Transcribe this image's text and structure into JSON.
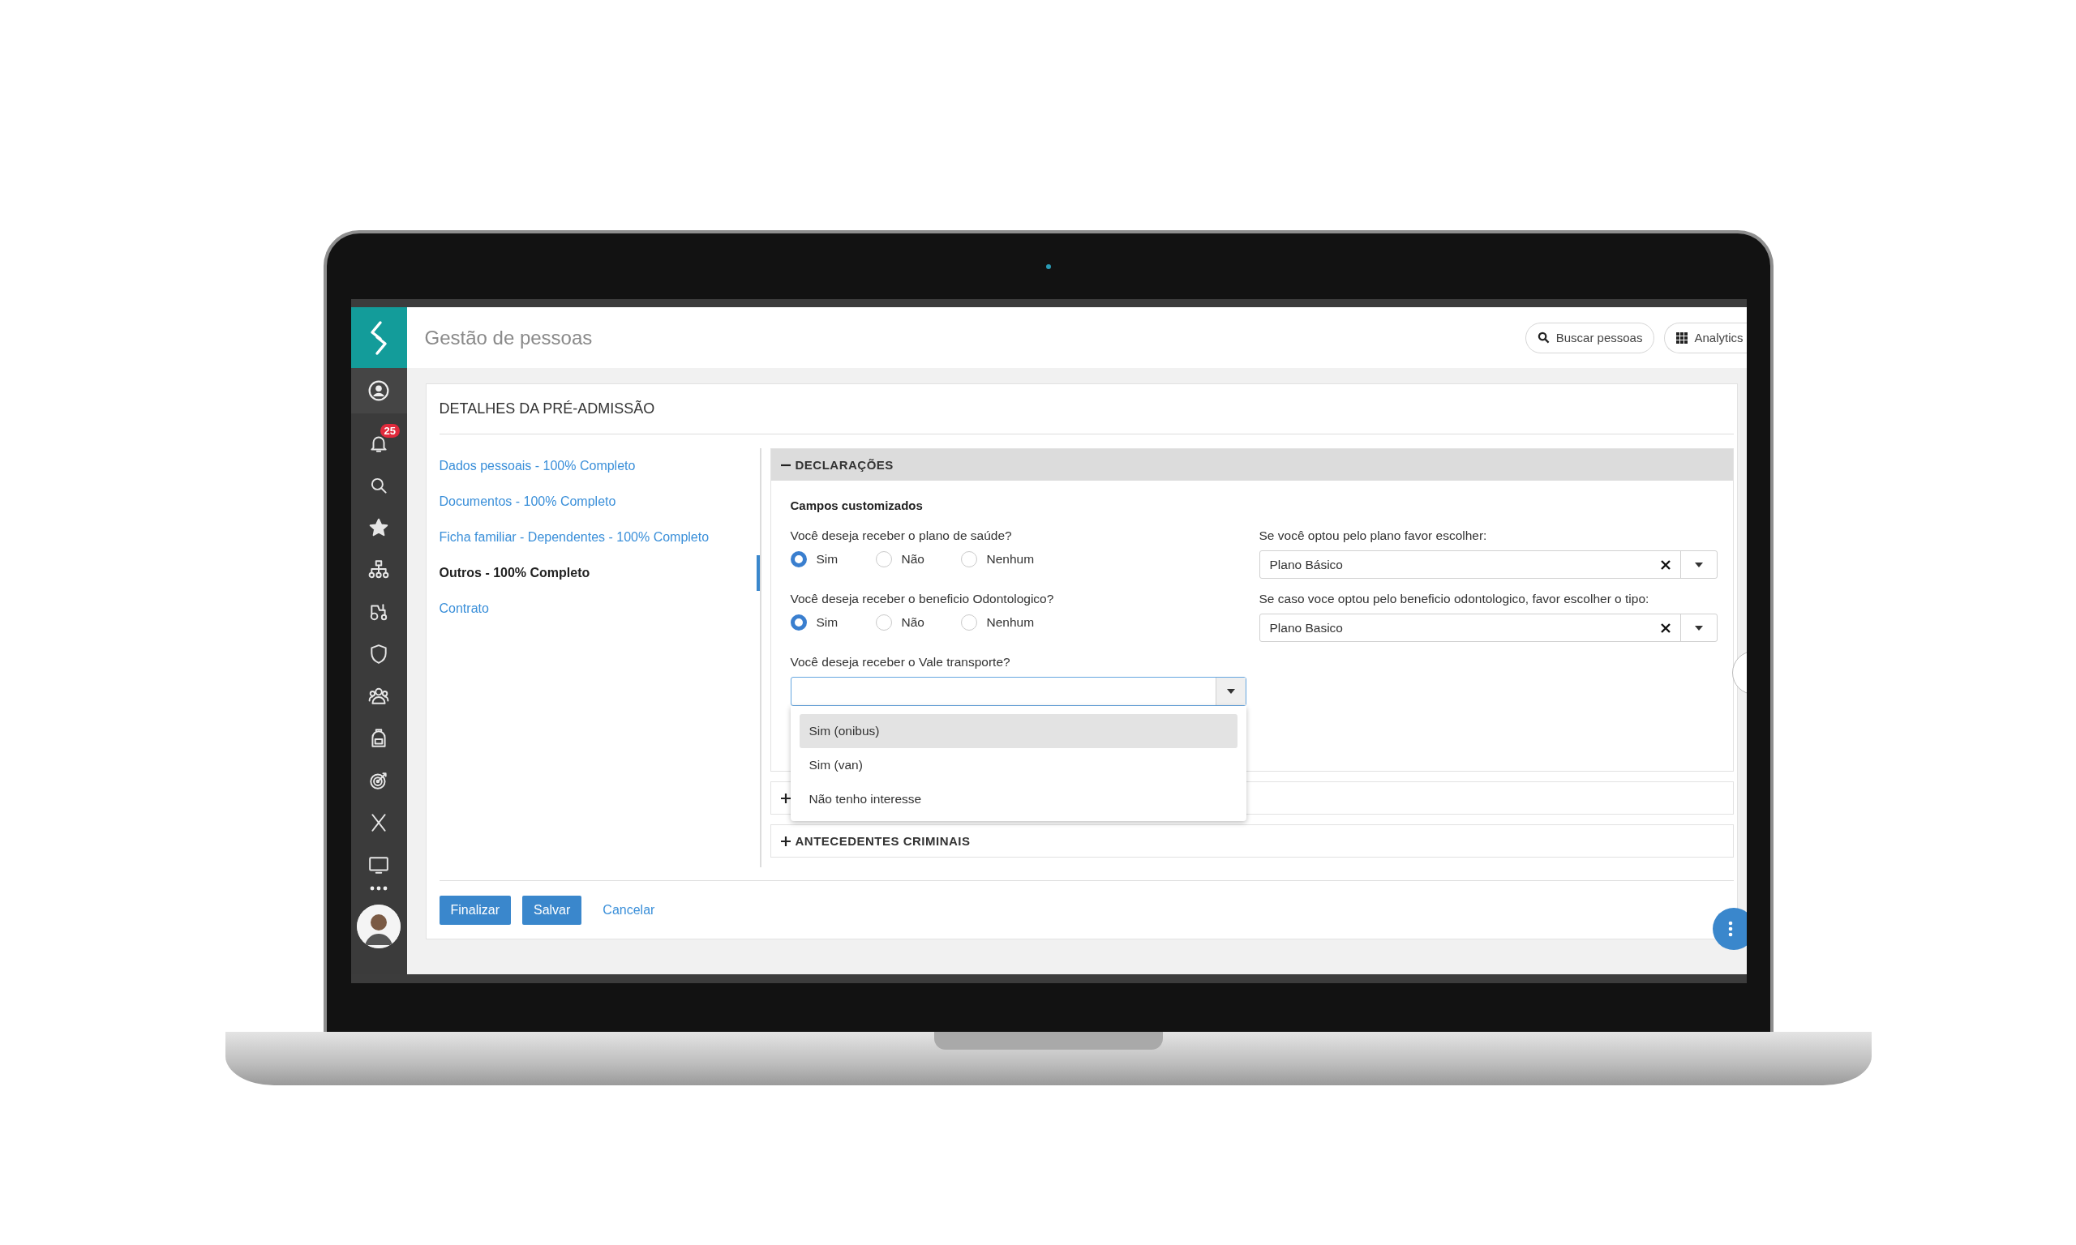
{
  "header": {
    "title": "Gestão de pessoas",
    "buttons": [
      {
        "label": "Buscar pessoas",
        "kind": "search"
      },
      {
        "label": "Analytics",
        "kind": "apps"
      }
    ]
  },
  "sidebar": {
    "notification_count": "25"
  },
  "page": {
    "title": "DETALHES DA PRÉ-ADMISSÃO"
  },
  "steps": [
    {
      "label": "Dados pessoais - 100% Completo",
      "selected": false
    },
    {
      "label": "Documentos - 100% Completo",
      "selected": false
    },
    {
      "label": "Ficha familiar - Dependentes - 100% Completo",
      "selected": false
    },
    {
      "label": "Outros - 100% Completo",
      "selected": true
    },
    {
      "label": "Contrato",
      "selected": false
    }
  ],
  "sections": [
    {
      "title": "DECLARAÇÕES",
      "expanded": true
    },
    {
      "expanded": false
    },
    {
      "title": "ANTECEDENTES CRIMINAIS",
      "expanded": false
    }
  ],
  "form": {
    "heading": "Campos customizados",
    "questions": [
      {
        "kind": "radio",
        "label": "Você deseja receber o plano de saúde?",
        "options": [
          {
            "label": "Sim",
            "selected": true
          },
          {
            "label": "Não",
            "selected": false
          },
          {
            "label": "Nenhum",
            "selected": false
          }
        ]
      },
      {
        "kind": "radio",
        "label": "Você deseja receber o beneficio Odontologico?",
        "options": [
          {
            "label": "Sim",
            "selected": true
          },
          {
            "label": "Não",
            "selected": false
          },
          {
            "label": "Nenhum",
            "selected": false
          }
        ]
      },
      {
        "kind": "select",
        "label": "Você deseja receber o Vale transporte?",
        "expanded": true,
        "options": [
          {
            "label": "Sim (onibus)",
            "selected": true
          },
          {
            "label": "Sim (van)",
            "selected": false
          },
          {
            "label": "Não tenho interesse",
            "selected": false
          }
        ]
      }
    ],
    "choices": [
      {
        "label": "Se você optou pelo plano favor escolher:",
        "value": "Plano Básico"
      },
      {
        "label": "Se caso voce optou pelo beneficio odontologico, favor escolher o tipo:",
        "value": "Plano Basico"
      }
    ]
  },
  "actions": [
    {
      "label": "Finalizar",
      "kind": "primary"
    },
    {
      "label": "Salvar",
      "kind": "primary"
    },
    {
      "label": "Cancelar",
      "kind": "link"
    }
  ]
}
